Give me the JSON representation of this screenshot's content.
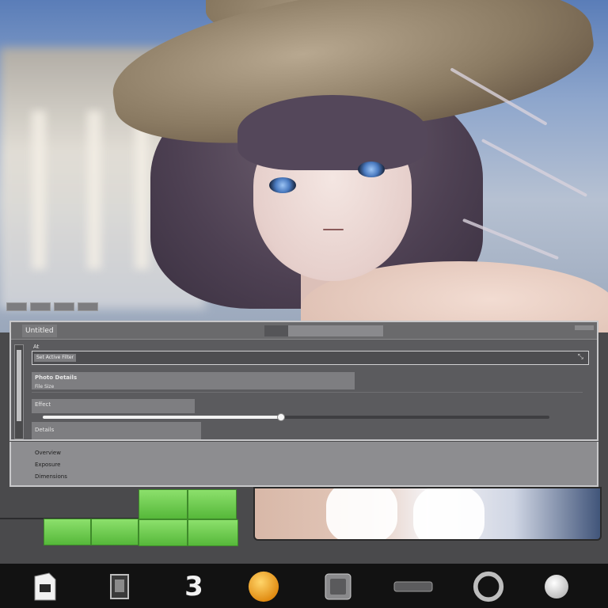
{
  "artwork": {
    "subject": "",
    "colors": {
      "sky": "#5a7db8",
      "hat": "#8a7a62",
      "hair": "#4d4052",
      "eyes": "#4a7ac0",
      "skin": "#e6cfcb"
    }
  },
  "toolbar": {
    "mini_tabs": [
      "",
      "",
      "",
      ""
    ]
  },
  "panel": {
    "title": "Untitled",
    "header_mini": "",
    "rows": {
      "row1_small": "At",
      "row1_chip": "Set Active Filter",
      "row2_title": "Photo Details",
      "row2_sub": "File Size",
      "row3_label": "Effect",
      "row4_label": "Details"
    },
    "slider_value": 0.47
  },
  "sub_panel": {
    "lines": [
      "Overview",
      "Exposure",
      "Dimensions"
    ]
  },
  "colors": {
    "panel_bg": "#5b5b5e",
    "panel_border": "#c8c8ca",
    "accent_green": "#56b83a",
    "dock_bg": "#121212"
  },
  "dock": {
    "items": [
      {
        "name": "document-icon"
      },
      {
        "name": "frame-icon"
      },
      {
        "name": "three-icon",
        "glyph": "3"
      },
      {
        "name": "orange-orb-icon"
      },
      {
        "name": "square-button-icon"
      },
      {
        "name": "bar-icon"
      },
      {
        "name": "ring-icon"
      },
      {
        "name": "white-orb-icon"
      }
    ]
  }
}
